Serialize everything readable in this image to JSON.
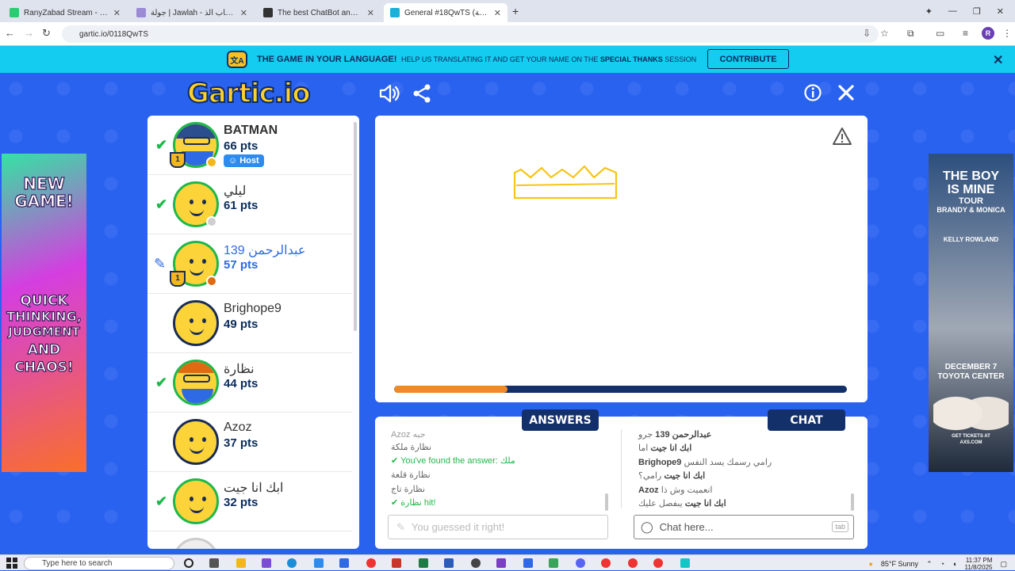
{
  "browser": {
    "tabs": [
      {
        "title": "RanyZabad Stream - Watch Live",
        "color": "#2ecc71"
      },
      {
        "title": "جولة | Jawlah - منصة الألعاب الذ",
        "color": "#9b8bd6"
      },
      {
        "title": "The best ChatBot and Widgets",
        "color": "#333333"
      },
      {
        "title": "General #18QwTS (العربية) - Ga",
        "color": "#1cb0d8"
      }
    ],
    "url": "gartic.io/0118QwTS",
    "profile_initial": "R"
  },
  "banner": {
    "title": "THE GAME IN YOUR LANGUAGE!",
    "text_prefix": "HELP US TRANSLATING IT AND GET YOUR NAME ON THE ",
    "text_bold": "SPECIAL THANKS",
    "text_suffix": " SESSION",
    "button": "CONTRIBUTE"
  },
  "game": {
    "logo": "Gartic.io",
    "timer_progress": 0.25
  },
  "players": [
    {
      "name": "BATMAN",
      "pts": "66 pts",
      "status": "guessed",
      "badge": "Host",
      "dot": "#f2b71c",
      "trophy": true
    },
    {
      "name": "ليلي",
      "pts": "61 pts",
      "status": "guessed",
      "dot": "#cfcfcf"
    },
    {
      "name": "عبدالرحمن 139",
      "pts": "57 pts",
      "status": "drawing",
      "dot": "#e06a14",
      "trophy": true
    },
    {
      "name": "Brighope9",
      "pts": "49 pts",
      "status": "none"
    },
    {
      "name": "نظارة",
      "pts": "44 pts",
      "status": "guessed"
    },
    {
      "name": "Azoz",
      "pts": "37 pts",
      "status": "none"
    },
    {
      "name": "ابك انا جيت",
      "pts": "32 pts",
      "status": "guessed"
    }
  ],
  "tabs": {
    "answers": "ANSWERS",
    "chat": "CHAT"
  },
  "answers": [
    {
      "text": "Azoz جبه",
      "type": "normal"
    },
    {
      "text": "نظارة ملكة",
      "type": "normal"
    },
    {
      "text": "You've found the answer: ملك",
      "type": "found"
    },
    {
      "text": "نظارة قلعة",
      "type": "normal"
    },
    {
      "text": "نظارة تاج",
      "type": "normal"
    },
    {
      "text": "نظارة hit!",
      "type": "hit"
    }
  ],
  "answer_placeholder": "You guessed it right!",
  "chat": [
    {
      "name": "عبدالرحمن 139",
      "text": "جرو"
    },
    {
      "name": "ابك انا جيت",
      "text": "اما"
    },
    {
      "name": "Brighope9",
      "text": "رامي رسمك يسد النفس"
    },
    {
      "name": "ابك انا جيت",
      "text": "رامي؟"
    },
    {
      "name": "Azoz",
      "text": "انعميت وش ذا"
    },
    {
      "name": "ابك انا جيت",
      "text": "يبفصل عليك"
    }
  ],
  "chat_placeholder": "Chat here...",
  "chat_tab_key": "tab",
  "ads": {
    "left": [
      "NEW",
      "GAME!",
      "QUICK",
      "THINKING,",
      "JUDGMENT",
      "AND",
      "CHAOS!"
    ],
    "right": [
      "THE BOY",
      "IS MINE",
      "TOUR",
      "BRANDY & MONICA",
      "KELLY ROWLAND",
      "DECEMBER 7",
      "TOYOTA CENTER",
      "GET TICKETS AT",
      "AXS.COM"
    ]
  },
  "taskbar": {
    "search": "Type here to search",
    "weather": "85°F  Sunny",
    "time": "11:37 PM",
    "date": "11/8/2025"
  }
}
